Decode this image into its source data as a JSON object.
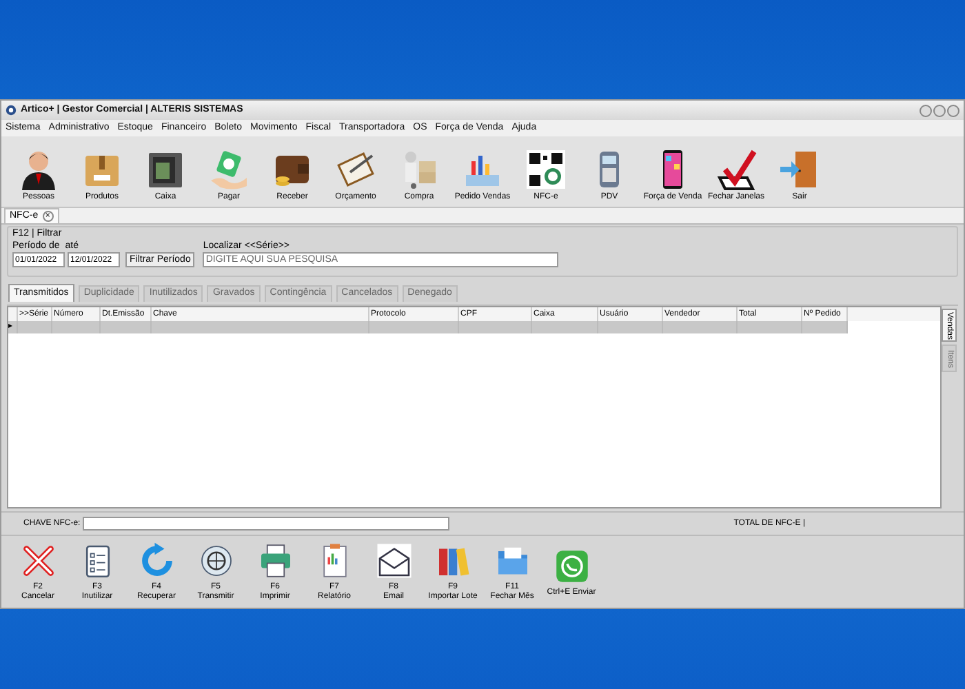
{
  "window": {
    "title": "Artico+ | Gestor Comercial | ALTERIS SISTEMAS"
  },
  "menu": [
    "Sistema",
    "Administrativo",
    "Estoque",
    "Financeiro",
    "Boleto",
    "Movimento",
    "Fiscal",
    "Transportadora",
    "OS",
    "Força de Venda",
    "Ajuda"
  ],
  "toolbar": [
    "Pessoas",
    "Produtos",
    "Caixa",
    "Pagar",
    "Receber",
    "Orçamento",
    "Compra",
    "Pedido Vendas",
    "NFC-e",
    "PDV",
    "Força de Venda",
    "Fechar Janelas",
    "Sair"
  ],
  "document_tab": {
    "label": "NFC-e",
    "close": "×"
  },
  "filter": {
    "title": "F12 | Filtrar",
    "period_label": "Período de",
    "until_label": "até",
    "date_from": "01/01/2022",
    "date_to": "12/01/2022",
    "filter_button": "Filtrar Período",
    "search_label": "Localizar <<Série>>",
    "search_placeholder": "DIGITE AQUI SUA PESQUISA"
  },
  "tabs": [
    {
      "label": "Transmitidos",
      "selected": true
    },
    {
      "label": "Duplicidade",
      "selected": false
    },
    {
      "label": "Inutilizados",
      "selected": false
    },
    {
      "label": "Gravados",
      "selected": false
    },
    {
      "label": "Contingência",
      "selected": false
    },
    {
      "label": "Cancelados",
      "selected": false
    },
    {
      "label": "Denegado",
      "selected": false
    }
  ],
  "table": {
    "columns": [
      ">>Série",
      "Número",
      "Dt.Emissão",
      "Chave",
      "Protocolo",
      "CPF",
      "Caixa",
      "Usuário",
      "Vendedor",
      "Total",
      "Nº Pedido"
    ],
    "row_marker": "▸"
  },
  "side_tabs": [
    {
      "label": "Vendas",
      "selected": true
    },
    {
      "label": "Itens",
      "selected": false
    }
  ],
  "footer": {
    "key_label": "CHAVE NFC-e:",
    "total_label": "TOTAL DE NFC-E  |"
  },
  "actions": [
    {
      "key": "F2",
      "label": "Cancelar"
    },
    {
      "key": "F3",
      "label": "Inutilizar"
    },
    {
      "key": "F4",
      "label": "Recuperar"
    },
    {
      "key": "F5",
      "label": "Transmitir"
    },
    {
      "key": "F6",
      "label": "Imprimir"
    },
    {
      "key": "F7",
      "label": "Relatório"
    },
    {
      "key": "F8",
      "label": "Email"
    },
    {
      "key": "F9",
      "label": "Importar Lote"
    },
    {
      "key": "F11",
      "label": "Fechar Mês"
    },
    {
      "label": "Ctrl+E Enviar"
    }
  ]
}
